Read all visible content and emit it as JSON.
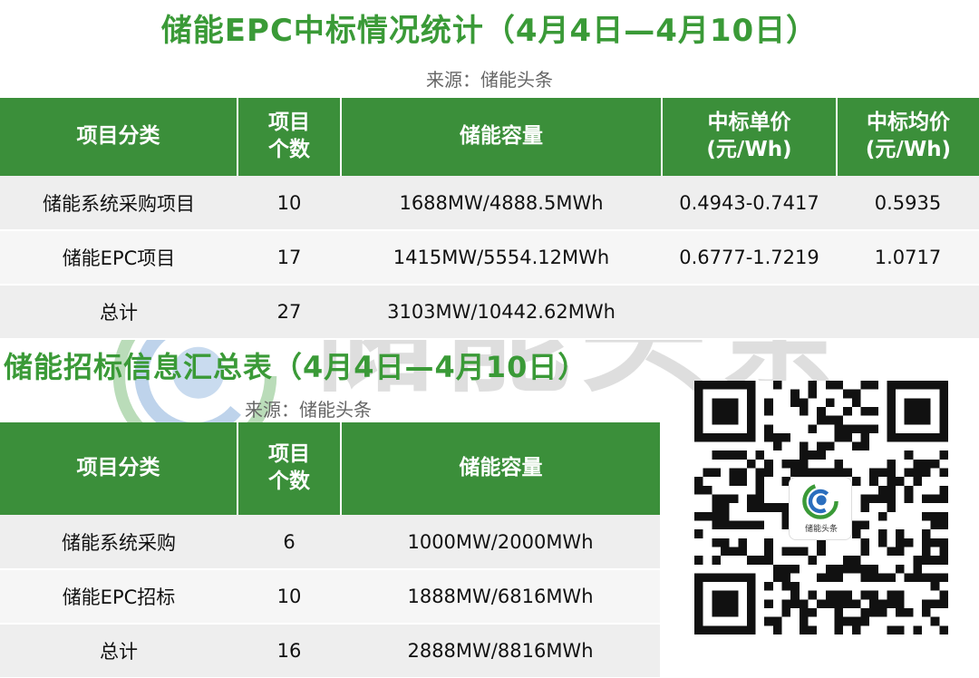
{
  "title1": "储能EPC中标情况统计（4月4日—4月10日）",
  "source1": "来源：储能头条",
  "table1": {
    "headers": [
      "项目分类",
      "项目个数",
      "储能容量",
      "中标单价(元/Wh)",
      "中标均价(元/Wh)"
    ],
    "headers_lines": [
      [
        "项目分类"
      ],
      [
        "项目",
        "个数"
      ],
      [
        "储能容量"
      ],
      [
        "中标单价",
        "(元/Wh)"
      ],
      [
        "中标均价",
        "(元/Wh)"
      ]
    ],
    "rows": [
      [
        "储能系统采购项目",
        "10",
        "1688MW/4888.5MWh",
        "0.4943-0.7417",
        "0.5935"
      ],
      [
        "储能EPC项目",
        "17",
        "1415MW/5554.12MWh",
        "0.6777-1.7219",
        "1.0717"
      ],
      [
        "总计",
        "27",
        "3103MW/10442.62MWh",
        "",
        ""
      ]
    ]
  },
  "title2": "储能招标信息汇总表（4月4日—4月10日）",
  "source2": "来源：储能头条",
  "table2": {
    "headers_lines": [
      [
        "项目分类"
      ],
      [
        "项目",
        "个数"
      ],
      [
        "储能容量"
      ]
    ],
    "rows": [
      [
        "储能系统采购",
        "6",
        "1000MW/2000MWh"
      ],
      [
        "储能EPC招标",
        "10",
        "1888MW/6816MWh"
      ],
      [
        "总计",
        "16",
        "2888MW/8816MWh"
      ]
    ]
  },
  "watermark": "储能头条",
  "qr_logo_label": "储能头条",
  "colors": {
    "brand_green": "#3a9a37",
    "header_green": "#3b8f3a",
    "row_gray": "#eeeeee"
  }
}
